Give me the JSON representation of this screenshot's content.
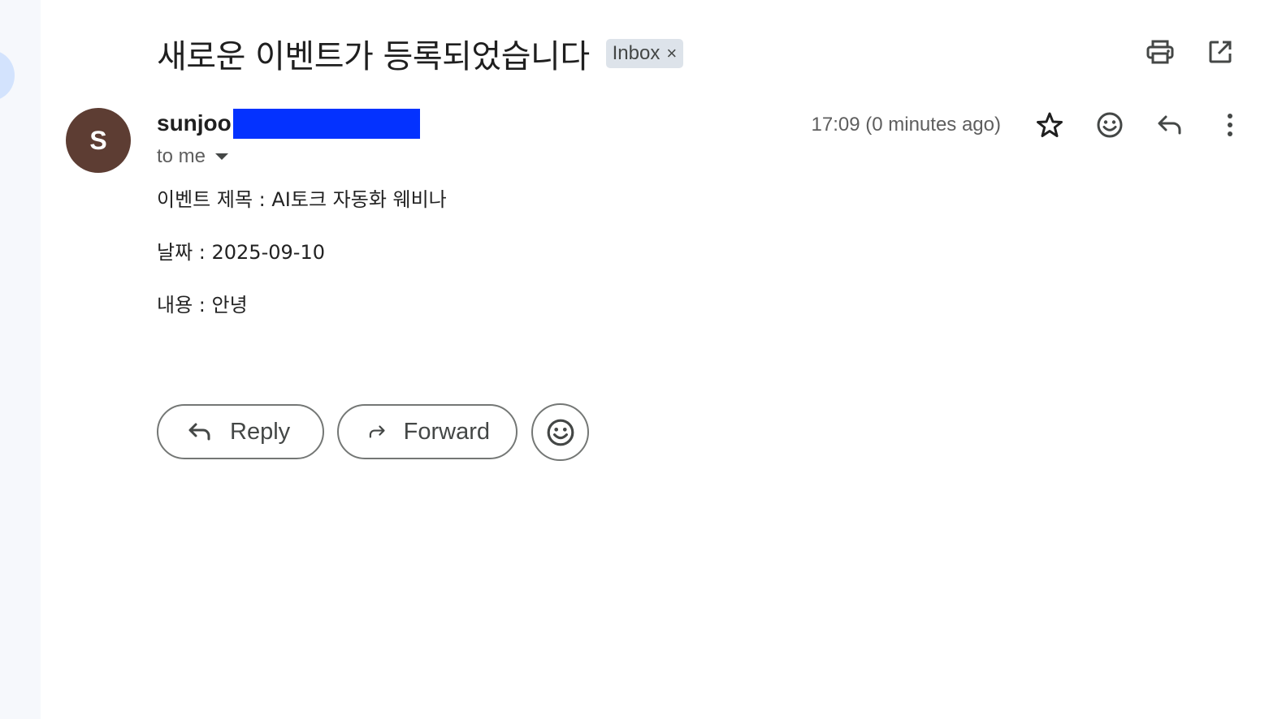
{
  "email": {
    "subject": "새로운 이벤트가 등록되었습니다",
    "label": "Inbox",
    "label_remove": "×",
    "sender": {
      "initial": "S",
      "name": "sunjoo",
      "avatar_color": "#5d3d33",
      "redaction_color": "#0432ff"
    },
    "recipient": "to me",
    "timestamp": "17:09 (0 minutes ago)",
    "body": [
      "이벤트 제목 : AI토크 자동화 웨비나",
      "날짜 : 2025-09-10",
      "내용 : 안녕"
    ]
  },
  "toolbar": {
    "print_icon": "printer-icon",
    "open_new_window_icon": "open-in-new-icon"
  },
  "header_actions": {
    "star_icon": "star-icon",
    "emoji_icon": "add-reaction-icon",
    "reply_icon": "reply-icon",
    "more_icon": "more-vert-icon"
  },
  "footer_actions": {
    "reply_label": "Reply",
    "forward_label": "Forward",
    "emoji_icon": "add-reaction-icon"
  }
}
